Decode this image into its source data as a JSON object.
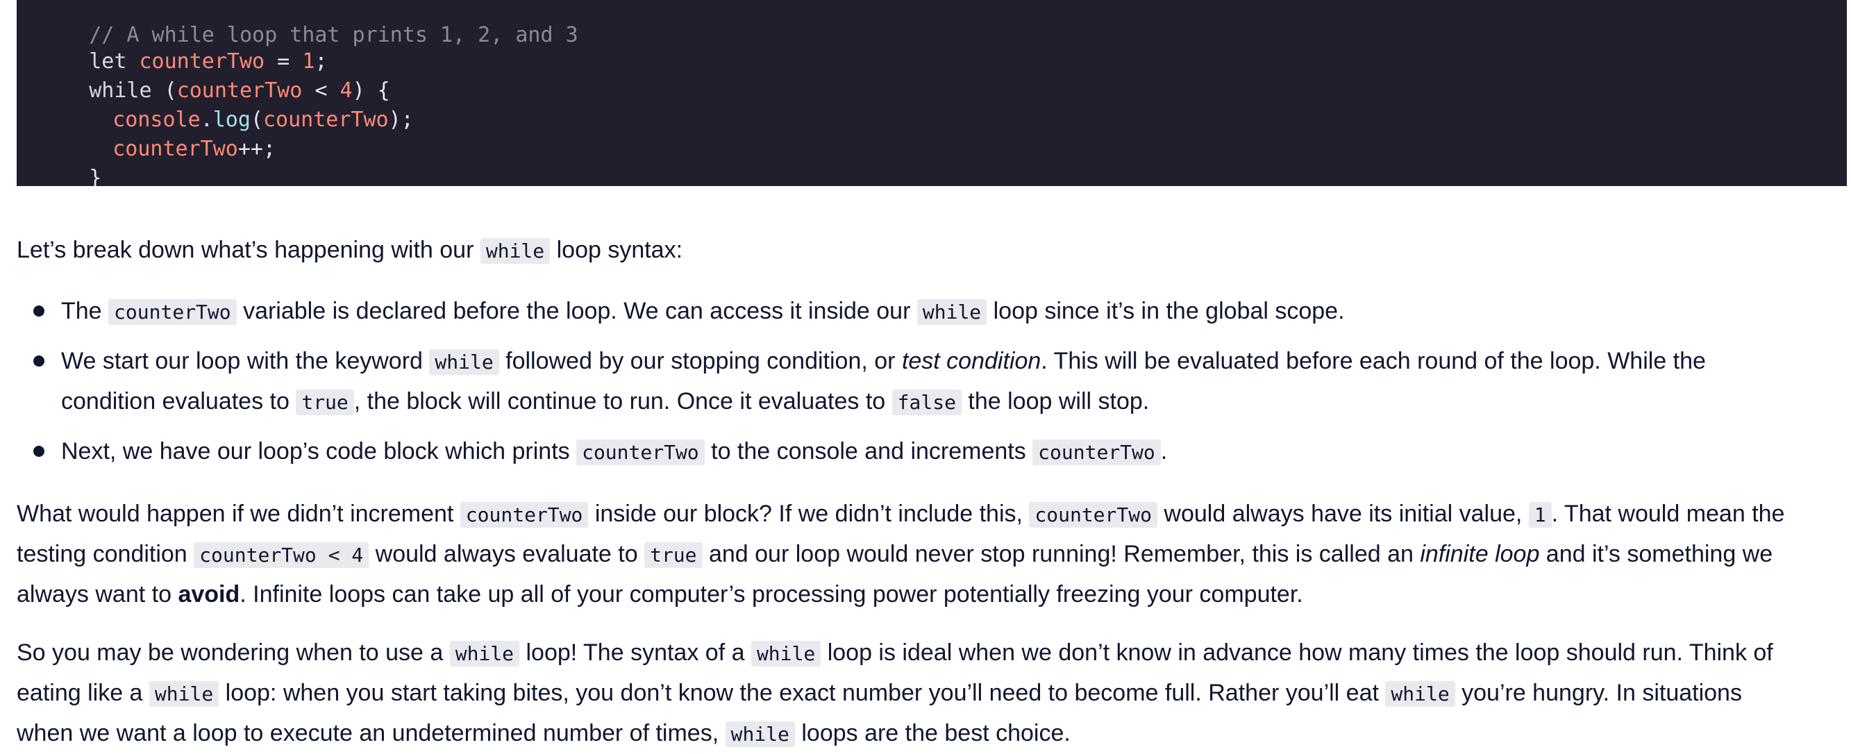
{
  "code": {
    "line0_comment": "// A while loop that prints 1, 2, and 3",
    "line1_let": "let ",
    "line1_var": "counterTwo",
    "line1_eq": " = ",
    "line1_num": "1",
    "line1_semi": ";",
    "line2_kw": "while ",
    "line2_paren_open": "(",
    "line2_var": "counterTwo",
    "line2_op": " < ",
    "line2_num": "4",
    "line2_rest": ") {",
    "line3_obj": "console",
    "line3_dot": ".",
    "line3_method": "log",
    "line3_paren_open": "(",
    "line3_arg": "counterTwo",
    "line3_rest": ");",
    "line4_var": "counterTwo",
    "line4_rest": "++;",
    "line5": "}"
  },
  "intro": {
    "before": "Let’s break down what’s happening with our ",
    "code": "while",
    "after": " loop syntax:"
  },
  "bullets": [
    {
      "t1": "The ",
      "c1": "counterTwo",
      "t2": " variable is declared before the loop. We can access it inside our ",
      "c2": "while",
      "t3": " loop since it’s in the global scope."
    },
    {
      "t1": "We start our loop with the keyword ",
      "c1": "while",
      "t2": " followed by our stopping condition, or ",
      "em": "test condition",
      "t3": ". This will be evaluated before each round of the loop. While the",
      "l2_t1": "condition evaluates to ",
      "l2_c1": "true",
      "l2_t2": ", the block will continue to run. Once it evaluates to ",
      "l2_c2": "false",
      "l2_t3": " the loop will stop."
    },
    {
      "t1": "Next, we have our loop’s code block which prints ",
      "c1": "counterTwo",
      "t2": " to the console and increments ",
      "c2": "counterTwo",
      "t3": "."
    }
  ],
  "para1": {
    "l1_t1": "What would happen if we didn’t increment ",
    "l1_c1": "counterTwo",
    "l1_t2": " inside our block? If we didn’t include this, ",
    "l1_c2": "counterTwo",
    "l1_t3": " would always have its initial value, ",
    "l1_c3": "1",
    "l1_t4": ". That would mean the",
    "l2_t1": "testing condition ",
    "l2_c1": "counterTwo < 4",
    "l2_t2": " would always evaluate to ",
    "l2_c2": "true",
    "l2_t3": " and our loop would never stop running! Remember, this is called an ",
    "l2_em": "infinite loop",
    "l2_t4": " and it’s something we",
    "l3_t1": "always want to ",
    "l3_strong": "avoid",
    "l3_t2": ". Infinite loops can take up all of your computer’s processing power potentially freezing your computer."
  },
  "para2": {
    "l1_t1": "So you may be wondering when to use a ",
    "l1_c1": "while",
    "l1_t2": " loop! The syntax of a ",
    "l1_c2": "while",
    "l1_t3": " loop is ideal when we don’t know in advance how many times the loop should run. Think of",
    "l2_t1": "eating like a ",
    "l2_c1": "while",
    "l2_t2": " loop: when you start taking bites, you don’t know the exact number you’ll need to become full. Rather you’ll eat ",
    "l2_c2": "while",
    "l2_t3": " you’re hungry. In situations",
    "l3_t1": "when we want a loop to execute an undetermined number of times, ",
    "l3_c1": "while",
    "l3_t2": " loops are the best choice."
  }
}
